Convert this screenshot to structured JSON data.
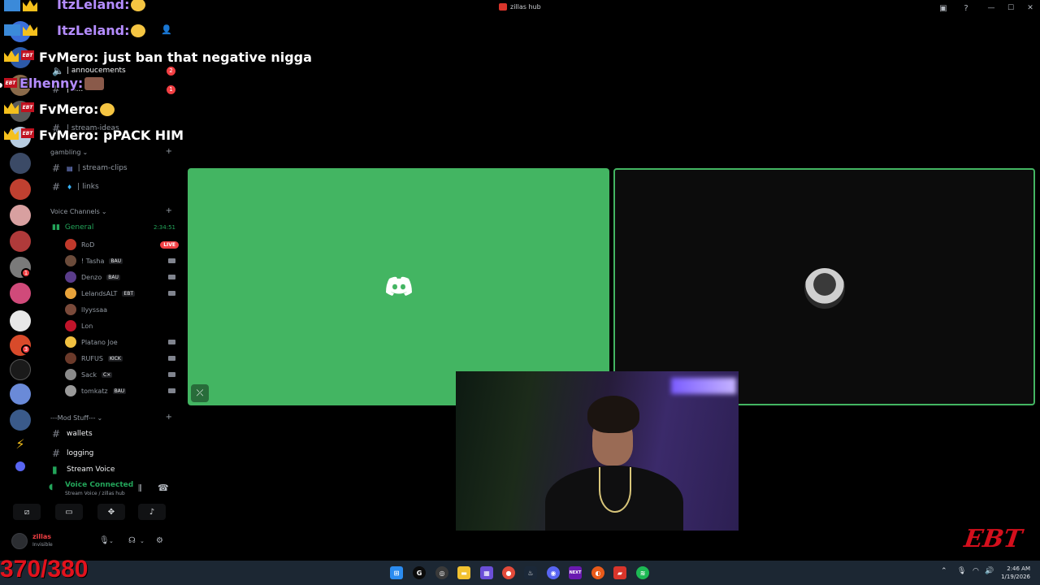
{
  "window": {
    "title": "zillas hub"
  },
  "chat_overlay": {
    "messages": [
      {
        "user": "ItzLeland:",
        "text": ""
      },
      {
        "user": "ItzLeland:",
        "text": ""
      },
      {
        "user": "FvMero:",
        "text": " just ban that negative nigga"
      },
      {
        "user": "Elhenny:",
        "text": ""
      },
      {
        "user": "FvMero:",
        "text": ""
      },
      {
        "user": "FvMero:",
        "text": " pPACK HIM"
      }
    ],
    "badge_text": "EBT"
  },
  "sidebar": {
    "channels_top": [
      {
        "label": "| annoucements",
        "badge": "2"
      },
      {
        "label": "| 8...",
        "badge": "1"
      },
      {
        "label": "| stream-ideas",
        "badge": ""
      }
    ],
    "category_gambling": "gambling",
    "channels_mid": [
      {
        "label": "| stream-clips"
      },
      {
        "label": "| links"
      }
    ],
    "category_voice": "Voice Channels",
    "voice_channel": {
      "name": "General",
      "timer": "2:34:51"
    },
    "voice_users": [
      {
        "name": "RoD",
        "tag": "",
        "live": "LIVE",
        "color": "#c0392b"
      },
      {
        "name": "! Tasha",
        "tag": "BAU",
        "live": "",
        "color": "#6b4b3a"
      },
      {
        "name": "Denzo",
        "tag": "BAU",
        "live": "",
        "color": "#5a3c8a"
      },
      {
        "name": "LelandsALT",
        "tag": "EBT",
        "live": "",
        "color": "#e8a33a"
      },
      {
        "name": "llyyssaa",
        "tag": "",
        "live": "",
        "color": "#7a4a3a"
      },
      {
        "name": "Lon",
        "tag": "",
        "live": "",
        "color": "#c0142a"
      },
      {
        "name": "Platano Joe",
        "tag": "",
        "live": "",
        "color": "#f0c040"
      },
      {
        "name": "RUFUS",
        "tag": "KICK",
        "live": "",
        "color": "#6b3a2a"
      },
      {
        "name": "Sack",
        "tag": "C×",
        "live": "",
        "color": "#8a8a8a"
      },
      {
        "name": "tomkatz",
        "tag": "BAU",
        "live": "",
        "color": "#9a9a9a"
      }
    ],
    "category_mod": "---Mod Stuff---",
    "channels_mod": [
      {
        "label": "wallets"
      },
      {
        "label": "logging"
      },
      {
        "label": "Stream Voice"
      }
    ]
  },
  "voice_panel": {
    "status": "Voice Connected",
    "location": "Stream Voice / zillas hub"
  },
  "user_panel": {
    "name": "zillas",
    "status": "Invisible"
  },
  "overlay": {
    "counter": "370/380",
    "logo": "EBT"
  },
  "taskbar": {
    "time": "2:46 AM",
    "date": "1/19/2026",
    "next_label": "NEXT"
  },
  "colors": {
    "discord_green": "#43b562",
    "voice_green": "#23a55a",
    "alert_red": "#f23f43",
    "counter_red": "#e3121d",
    "taskbar": "#1c2733"
  }
}
